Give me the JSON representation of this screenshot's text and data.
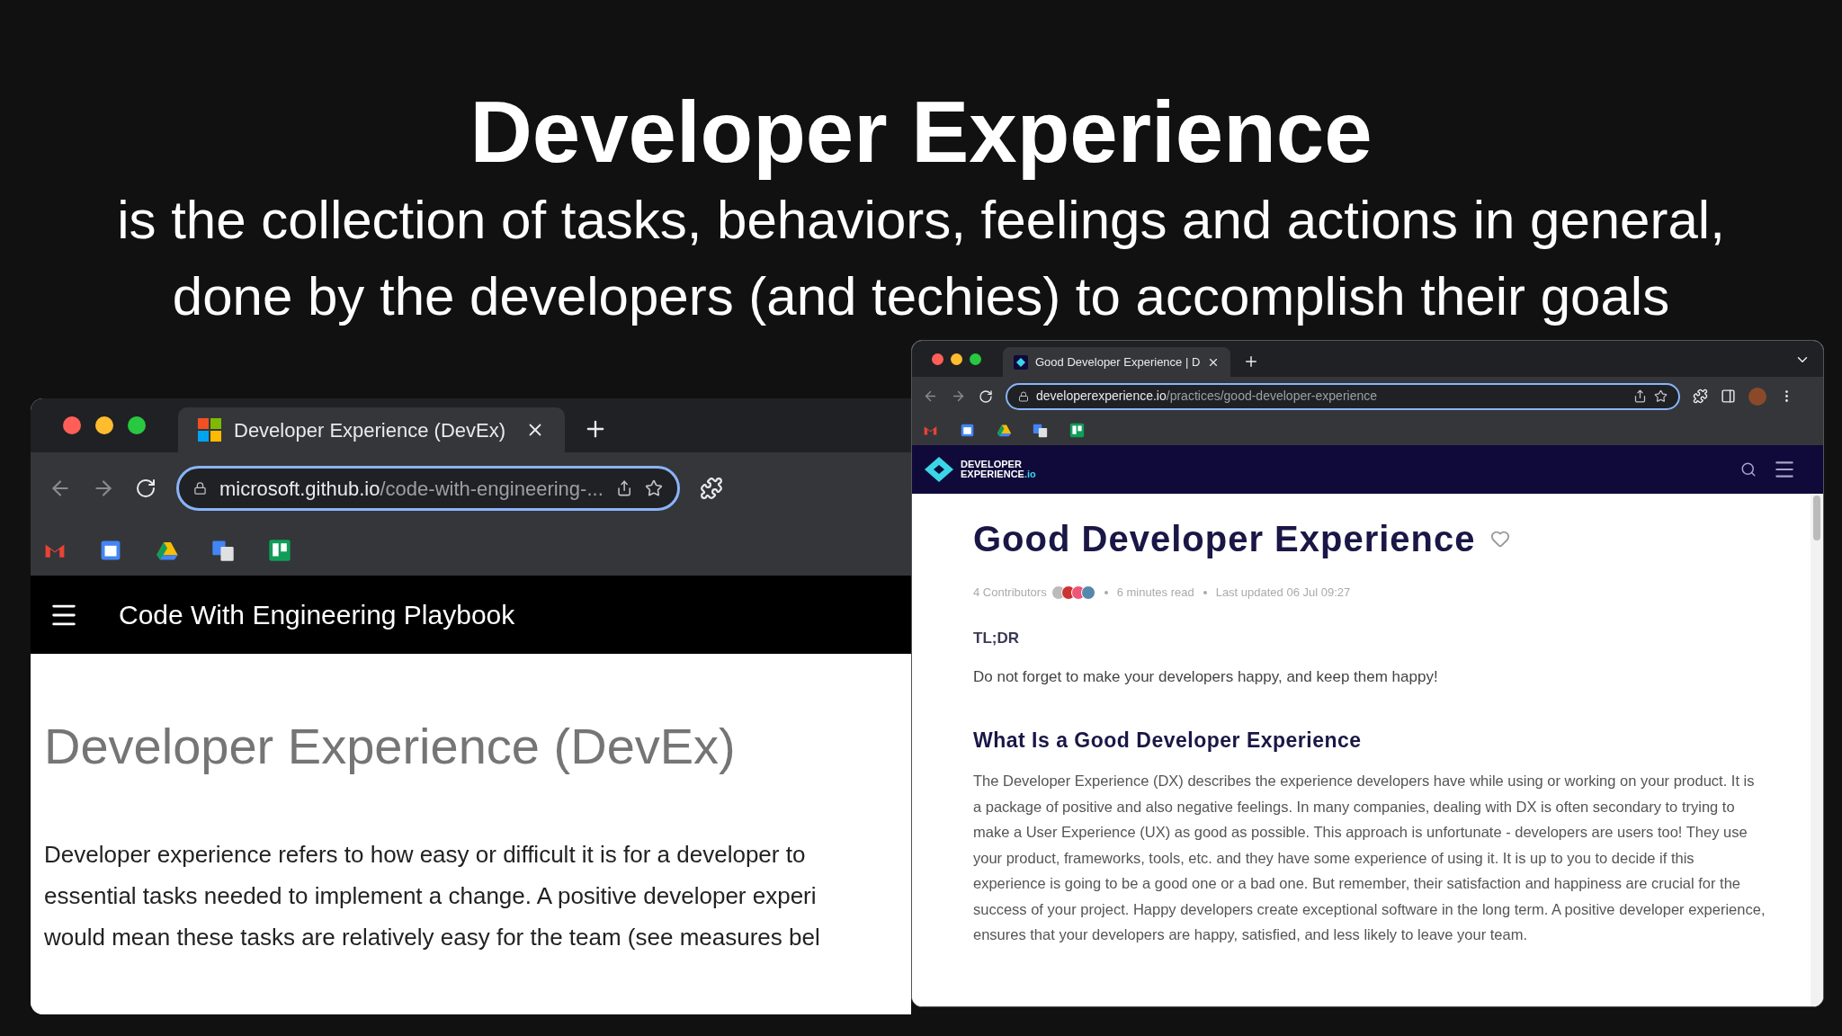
{
  "slide": {
    "title": "Developer Experience",
    "subtitle_lines": [
      "is the collection of tasks, behaviors, feelings and actions in general,",
      "done by the developers (and techies) to accomplish their goals"
    ]
  },
  "left_browser": {
    "tab": {
      "title": "Developer Experience (DevEx)"
    },
    "url": {
      "domain": "microsoft.github.io",
      "path": "/code-with-engineering-..."
    },
    "page": {
      "header_title": "Code With Engineering Playbook",
      "heading": "Developer Experience (DevEx)",
      "paragraph_lines": [
        "Developer experience refers to how easy or difficult it is for a developer to",
        "essential tasks needed to implement a change. A positive developer experi",
        "would mean these tasks are relatively easy for the team (see measures bel"
      ]
    }
  },
  "right_browser": {
    "tab": {
      "title": "Good Developer Experience | D"
    },
    "url": {
      "domain": "developerexperience.io",
      "path": "/practices/good-developer-experience"
    },
    "site": {
      "logo_line_1": "DEVELOPER",
      "logo_line_2": "EXPERIENCE",
      "logo_suffix": ".io"
    },
    "article": {
      "title": "Good Developer Experience",
      "contributors": "4 Contributors",
      "read_time": "6 minutes read",
      "last_updated": "Last updated 06 Jul 09:27",
      "tldr_label": "TL;DR",
      "tldr_text": "Do not forget to make your developers happy, and keep them happy!",
      "section_heading": "What Is a Good Developer Experience",
      "section_body": "The Developer Experience (DX) describes the experience developers have while using or working on your product. It is a package of positive and also negative feelings. In many companies, dealing with DX is often secondary to trying to make a User Experience (UX) as good as possible. This approach is unfortunate - developers are users too! They use your product, frameworks, tools, etc. and they have some experience of using it. It is up to you to decide if this experience is going to be a good one or a bad one. But remember, their satisfaction and happiness are crucial for the success of your project. Happy developers create exceptional software in the long term. A positive developer experience, ensures that your developers are happy, satisfied, and less likely to leave your team."
    }
  }
}
